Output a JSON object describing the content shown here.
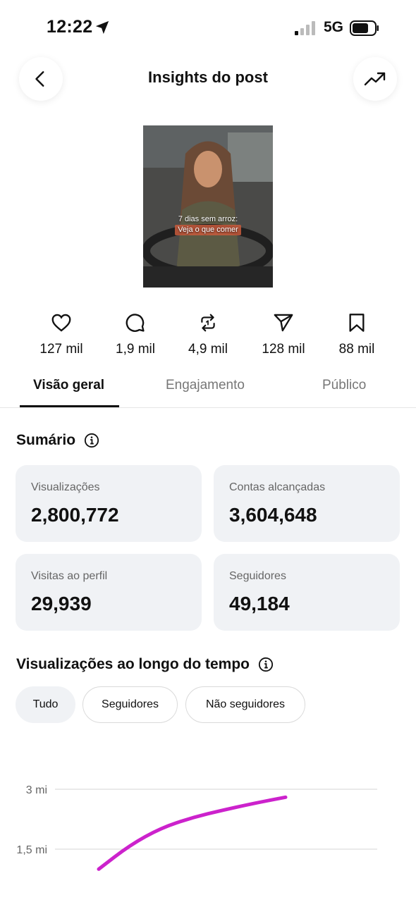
{
  "status_bar": {
    "time": "12:22",
    "network": "5G"
  },
  "header": {
    "title": "Insights do post"
  },
  "post": {
    "caption_line1": "7 dias sem arroz:",
    "caption_line2": "Veja o que comer"
  },
  "stats": [
    {
      "icon": "heart-icon",
      "value": "127 mil"
    },
    {
      "icon": "comment-icon",
      "value": "1,9 mil"
    },
    {
      "icon": "repost-icon",
      "value": "4,9 mil"
    },
    {
      "icon": "share-icon",
      "value": "128 mil"
    },
    {
      "icon": "bookmark-icon",
      "value": "88 mil"
    }
  ],
  "tabs": [
    {
      "label": "Visão geral",
      "active": true
    },
    {
      "label": "Engajamento",
      "active": false
    },
    {
      "label": "Público",
      "active": false
    }
  ],
  "summary": {
    "title": "Sumário",
    "cards": [
      {
        "label": "Visualizações",
        "value": "2,800,772"
      },
      {
        "label": "Contas alcançadas",
        "value": "3,604,648"
      },
      {
        "label": "Visitas ao perfil",
        "value": "29,939"
      },
      {
        "label": "Seguidores",
        "value": "49,184"
      }
    ]
  },
  "views_over_time": {
    "title": "Visualizações ao longo do tempo",
    "filters": [
      {
        "label": "Tudo",
        "selected": true
      },
      {
        "label": "Seguidores",
        "selected": false
      },
      {
        "label": "Não seguidores",
        "selected": false
      }
    ]
  },
  "colors": {
    "line": "#cc22cc",
    "card_bg": "#f0f2f5",
    "accent": "#111111"
  },
  "chart_data": {
    "type": "line",
    "title": "",
    "xlabel": "",
    "ylabel": "",
    "y_tick_labels": [
      "3 mi",
      "1,5 mi"
    ],
    "y_ticks": [
      3000000,
      1500000
    ],
    "ylim": [
      0,
      3000000
    ],
    "grid": true,
    "series": [
      {
        "values": [
          1000000,
          1600000,
          2030000,
          2290000,
          2480000,
          2650000,
          2800000
        ]
      }
    ]
  }
}
